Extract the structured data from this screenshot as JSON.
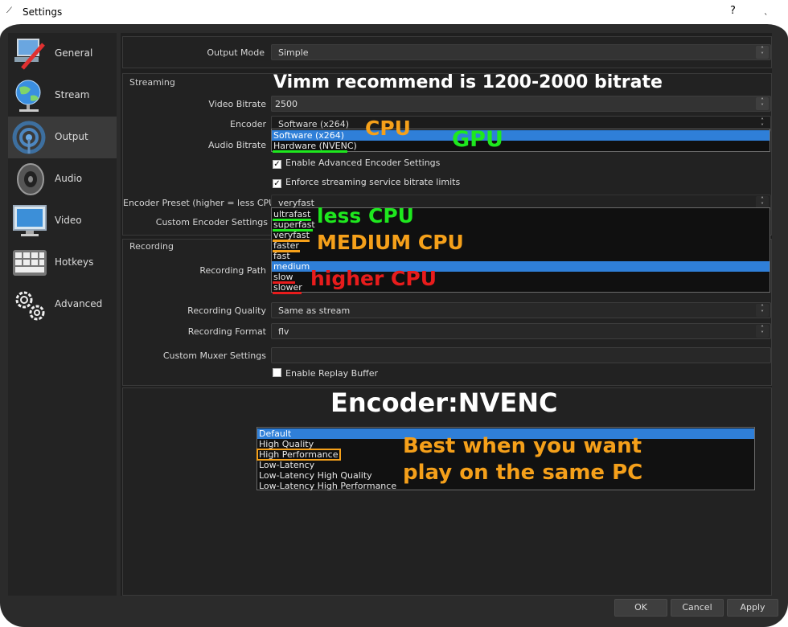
{
  "window": {
    "title": "Settings",
    "help": "?",
    "close": "ˎ"
  },
  "sidebar": {
    "items": [
      {
        "label": "General",
        "icon": "general-icon"
      },
      {
        "label": "Stream",
        "icon": "globe-icon"
      },
      {
        "label": "Output",
        "icon": "broadcast-icon"
      },
      {
        "label": "Audio",
        "icon": "speaker-icon"
      },
      {
        "label": "Video",
        "icon": "monitor-icon"
      },
      {
        "label": "Hotkeys",
        "icon": "keyboard-icon"
      },
      {
        "label": "Advanced",
        "icon": "gears-icon"
      }
    ],
    "active": "Output"
  },
  "output": {
    "mode_label": "Output Mode",
    "mode_value": "Simple",
    "streaming": {
      "group_title": "Streaming",
      "video_bitrate_label": "Video Bitrate",
      "video_bitrate_value": "2500",
      "encoder_label": "Encoder",
      "encoder_value": "Software (x264)",
      "encoder_options": [
        "Software (x264)",
        "Hardware (NVENC)"
      ],
      "audio_bitrate_label": "Audio Bitrate",
      "adv_encoder_label": "Enable Advanced Encoder Settings",
      "enforce_label": "Enforce streaming service bitrate limits",
      "preset_label": "Encoder Preset (higher = less CPU)",
      "preset_value": "veryfast",
      "preset_options": [
        "ultrafast",
        "superfast",
        "veryfast",
        "faster",
        "fast",
        "medium",
        "slow",
        "slower"
      ],
      "custom_label": "Custom Encoder Settings"
    },
    "recording": {
      "group_title": "Recording",
      "path_label": "Recording Path",
      "quality_label": "Recording Quality",
      "quality_value": "Same as stream",
      "format_label": "Recording Format",
      "format_value": "flv",
      "muxer_label": "Custom Muxer Settings",
      "replay_label": "Enable Replay Buffer"
    },
    "nvenc_presets": [
      "Default",
      "High Quality",
      "High Performance",
      "Low-Latency",
      "Low-Latency High Quality",
      "Low-Latency High Performance"
    ]
  },
  "annotations": {
    "bitrate_tip": "Vimm recommend is 1200-2000 bitrate",
    "cpu": "CPU",
    "gpu": "GPU",
    "less_cpu": "less CPU",
    "medium_cpu": "MEDIUM CPU",
    "higher_cpu": "higher CPU",
    "nvenc_title": "Encoder:NVENC",
    "best_line1": "Best when you want",
    "best_line2": "play on the same PC"
  },
  "buttons": {
    "ok": "OK",
    "cancel": "Cancel",
    "apply": "Apply"
  },
  "colors": {
    "green": "#1ee81e",
    "orange": "#f5a01a",
    "red": "#e81c1c",
    "selection": "#2f7fd8"
  }
}
